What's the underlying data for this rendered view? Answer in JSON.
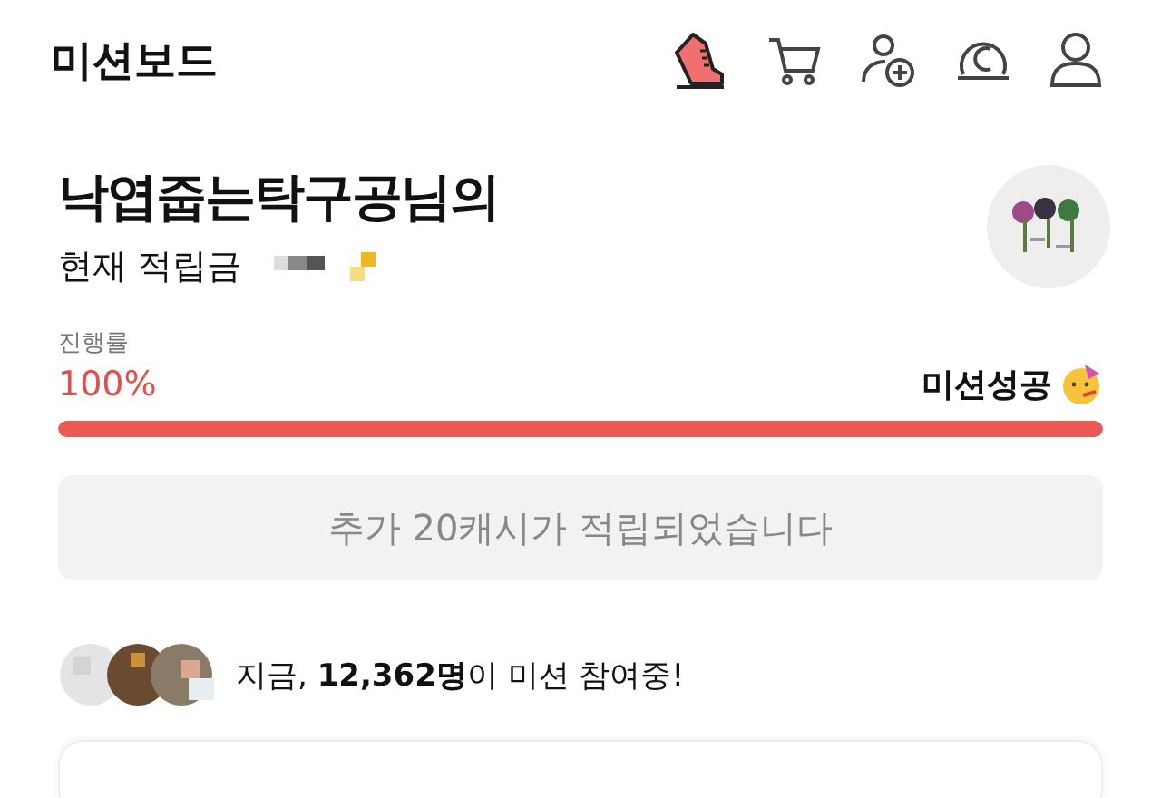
{
  "header": {
    "title": "미션보드",
    "icons": [
      {
        "kind": "sneaker"
      },
      {
        "kind": "cart"
      },
      {
        "kind": "add-friend"
      },
      {
        "kind": "coin"
      },
      {
        "kind": "profile"
      }
    ]
  },
  "profile": {
    "name": "낙엽줍는탁구공님의",
    "balance_label": "현재 적립금"
  },
  "progress": {
    "label": "진행률",
    "percent": "100%",
    "level": 1,
    "status": "미션성공"
  },
  "notice": "추가 20캐시가 적립되었습니다",
  "participants": {
    "text": "지금, **12,362명**이 미션 참여중!"
  }
}
